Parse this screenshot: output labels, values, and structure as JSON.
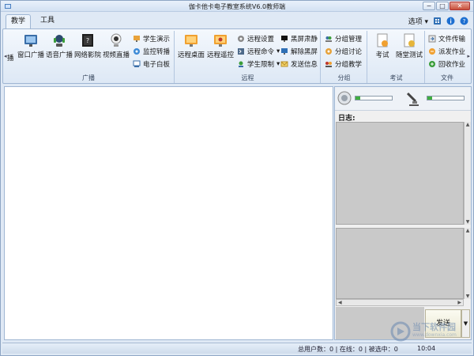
{
  "window": {
    "title": "伽卡他卡电子教室系统V6.0教师端",
    "controls": [
      "−",
      "□",
      "✕"
    ]
  },
  "tabs": [
    {
      "label": "教学",
      "active": true
    },
    {
      "label": "工具",
      "active": false
    }
  ],
  "tab_right": {
    "options_label": "选项",
    "icons": [
      "grid-icon",
      "info-icon",
      "help-icon"
    ]
  },
  "ribbon": {
    "groups": [
      {
        "label": "广播",
        "big_buttons": [
          "窗口广播",
          "语音广播",
          "网络影院",
          "视频直播"
        ],
        "small_buttons": [
          "学生演示",
          "监控转播",
          "电子白板"
        ],
        "left_cut_label": "播"
      },
      {
        "label": "远程",
        "big_buttons": [
          "远程桌面",
          "远程遥控"
        ],
        "small_buttons": [
          "远程设置",
          "远程命令",
          "学生限制",
          "黑屏肃静",
          "解除黑屏",
          "发送信息"
        ]
      },
      {
        "label": "分组",
        "small_buttons": [
          "分组管理",
          "分组讨论",
          "分组教学"
        ]
      },
      {
        "label": "考试",
        "big_buttons": [
          "考试",
          "随堂测试"
        ]
      },
      {
        "label": "文件",
        "small_buttons": [
          "文件传输",
          "派发作业",
          "回收作业"
        ]
      }
    ]
  },
  "right_pane": {
    "log_label": "日志:",
    "send_label": "发送",
    "speaker_volume_fraction": 0.12,
    "mic_volume_fraction": 0.12
  },
  "status": {
    "text": "总用户数：0 | 在线：0 | 被选中：0",
    "time": "10:04"
  },
  "watermark": {
    "text": "当下软件园",
    "url": "www.downxia.com"
  },
  "colors": {
    "window_bg": "#dfe9f5",
    "accent_orange": "#f0a030",
    "accent_green": "#3fae3f"
  }
}
